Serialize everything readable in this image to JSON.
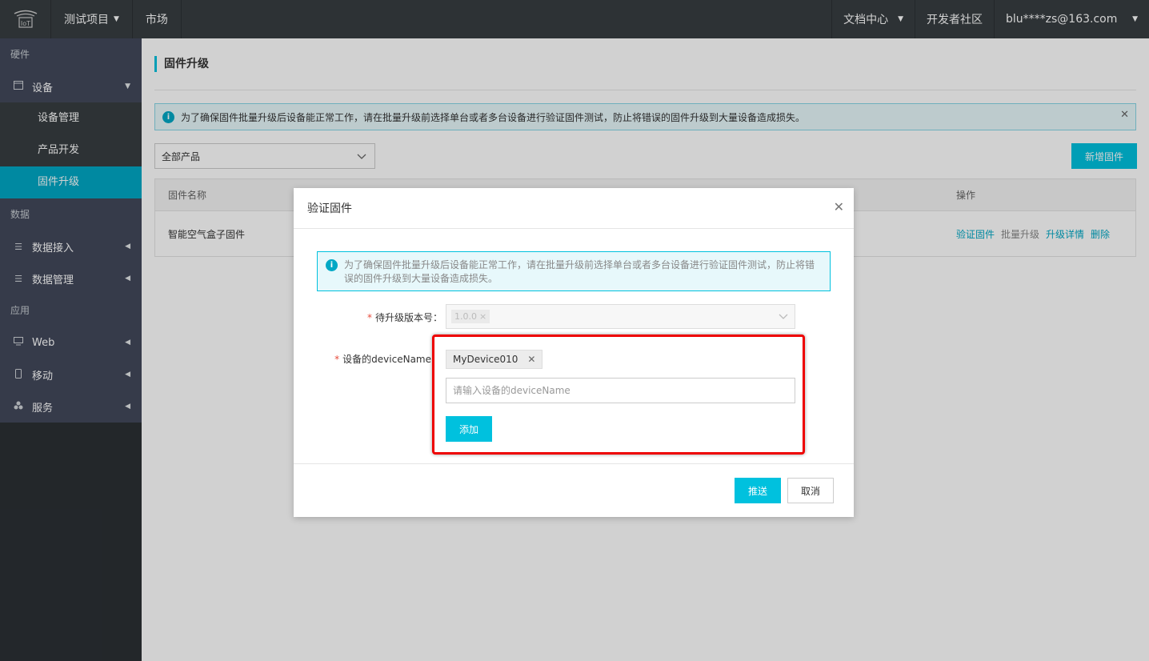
{
  "topbar": {
    "project": "测试项目",
    "market": "市场",
    "docs": "文档中心",
    "community": "开发者社区",
    "user": "blu****zs@163.com"
  },
  "sidebar": {
    "section_hardware": "硬件",
    "device_group": "设备",
    "device_manage": "设备管理",
    "product_dev": "产品开发",
    "firmware_upgrade": "固件升级",
    "section_data": "数据",
    "data_access": "数据接入",
    "data_manage": "数据管理",
    "section_app": "应用",
    "web": "Web",
    "mobile": "移动",
    "service": "服务"
  },
  "page": {
    "title": "固件升级",
    "alert": "为了确保固件批量升级后设备能正常工作，请在批量升级前选择单台或者多台设备进行验证固件测试，防止将错误的固件升级到大量设备造成损失。",
    "product_filter": "全部产品",
    "add_firmware": "新增固件",
    "table": {
      "col_name": "固件名称",
      "col_ops": "操作",
      "rows": [
        {
          "name": "智能空气盒子固件",
          "op_verify": "验证固件",
          "op_batch": "批量升级",
          "op_detail": "升级详情",
          "op_delete": "删除"
        }
      ]
    }
  },
  "modal": {
    "title": "验证固件",
    "alert": "为了确保固件批量升级后设备能正常工作，请在批量升级前选择单台或者多台设备进行验证固件测试，防止将错误的固件升级到大量设备造成损失。",
    "version_label": "待升级版本号：",
    "version_value": "1.0.0",
    "device_label": "设备的deviceName：",
    "device_tag": "MyDevice010",
    "device_placeholder": "请输入设备的deviceName",
    "add_button": "添加",
    "push_button": "推送",
    "cancel_button": "取消"
  },
  "colors": {
    "accent": "#00c1de",
    "topbar": "#373d41",
    "sidebar": "#2b3034",
    "highlight": "#e00000"
  }
}
